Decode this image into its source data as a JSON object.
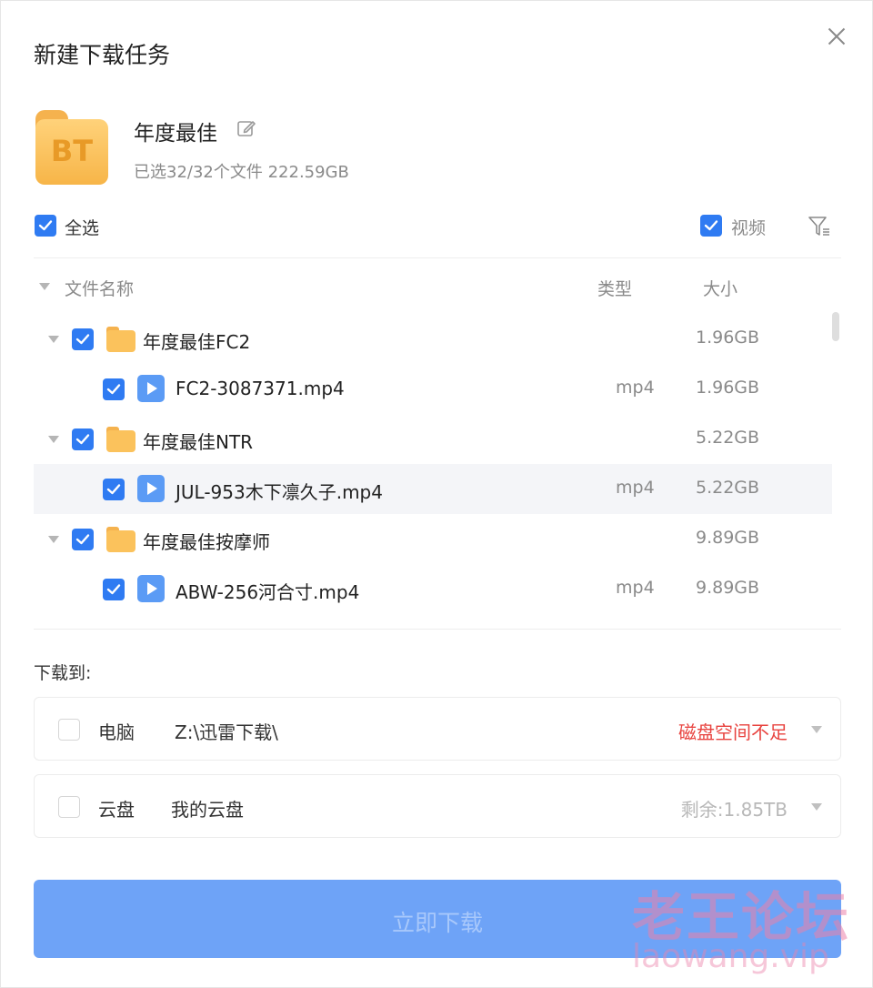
{
  "dialog": {
    "title": "新建下载任务"
  },
  "task": {
    "icon_text": "BT",
    "name": "年度最佳",
    "info": "已选32/32个文件 222.59GB"
  },
  "toolbar": {
    "select_all_label": "全选",
    "select_all_checked": true,
    "video_filter_label": "视频",
    "video_filter_checked": true
  },
  "columns": {
    "name": "文件名称",
    "type": "类型",
    "size": "大小"
  },
  "files": [
    {
      "kind": "folder",
      "name": "年度最佳FC2",
      "type": "",
      "size": "1.96GB",
      "checked": true,
      "expanded": true
    },
    {
      "kind": "video",
      "name": "FC2-3087371.mp4",
      "type": "mp4",
      "size": "1.96GB",
      "checked": true
    },
    {
      "kind": "folder",
      "name": "年度最佳NTR",
      "type": "",
      "size": "5.22GB",
      "checked": true,
      "expanded": true
    },
    {
      "kind": "video",
      "name": "JUL-953木下凛久子.mp4",
      "type": "mp4",
      "size": "5.22GB",
      "checked": true,
      "highlighted": true
    },
    {
      "kind": "folder",
      "name": "年度最佳按摩师",
      "type": "",
      "size": "9.89GB",
      "checked": true,
      "expanded": true
    },
    {
      "kind": "video",
      "name": "ABW-256河合寸.mp4",
      "type": "mp4",
      "size": "9.89GB",
      "checked": true
    }
  ],
  "download_to": {
    "label": "下载到:",
    "destinations": [
      {
        "name": "电脑",
        "path": "Z:\\迅雷下载\\",
        "status": "磁盘空间不足",
        "status_color": "#e8433f",
        "checked": false
      },
      {
        "name": "云盘",
        "path": "我的云盘",
        "status": "剩余:1.85TB",
        "status_color": "#b8b8b8",
        "checked": false
      }
    ]
  },
  "action": {
    "download_label": "立即下载"
  },
  "watermark": {
    "cn": "老王论坛",
    "en": "laowang.vip"
  },
  "colors": {
    "accent": "#2f7bf2",
    "button": "#6ea3f7",
    "folder": "#fbc25c"
  }
}
